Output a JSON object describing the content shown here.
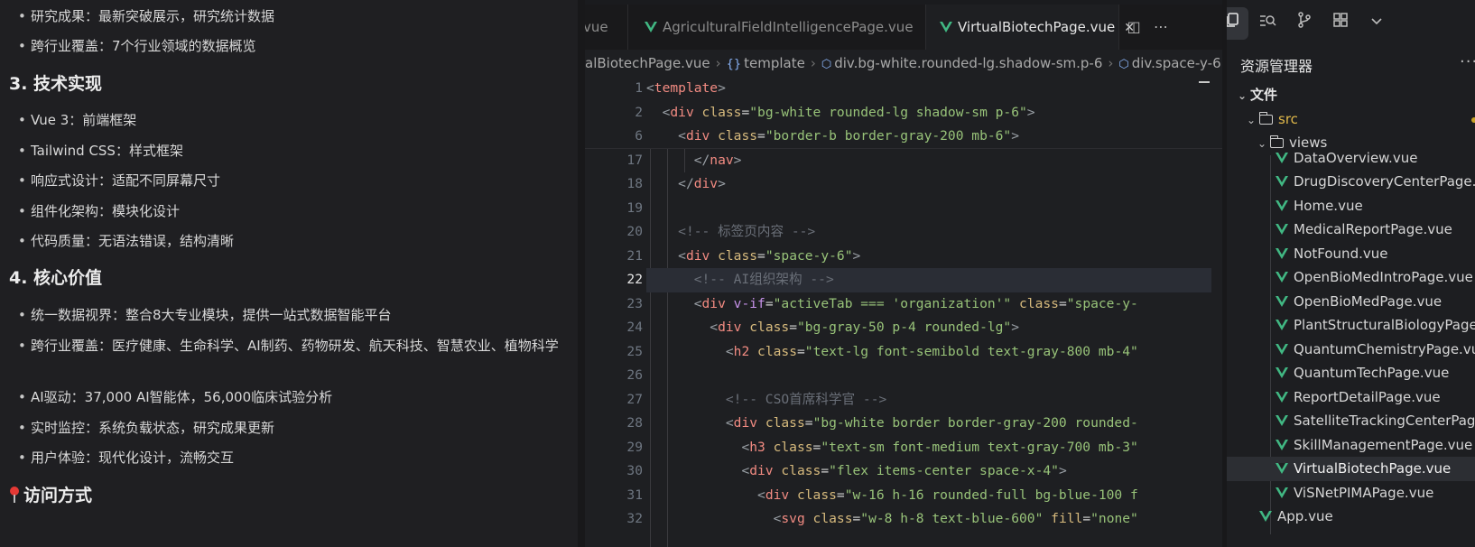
{
  "chat": {
    "items_top": [
      "研究成果：最新突破展示，研究统计数据",
      "跨行业覆盖：7个行业领域的数据概览"
    ],
    "section3_title": "3. 技术实现",
    "section3_items": [
      "Vue 3：前端框架",
      "Tailwind CSS：样式框架",
      "响应式设计：适配不同屏幕尺寸",
      "组件化架构：模块化设计",
      "代码质量：无语法错误，结构清晰"
    ],
    "section4_title": "4. 核心价值",
    "section4_items": [
      "统一数据视界：整合8大专业模块，提供一站式数据智能平台",
      "跨行业覆盖：医疗健康、生命科学、AI制药、药物研发、航天科技、智慧农业、植物科学",
      "AI驱动：37,000 AI智能体，56,000临床试验分析",
      "实时监控：系统负载状态，研究成果更新",
      "用户体验：现代化设计，流畅交互"
    ],
    "access_title": "访问方式"
  },
  "editor": {
    "tabs": [
      {
        "label": "vue",
        "active": false
      },
      {
        "label": "AgriculturalFieldIntelligencePage.vue",
        "active": false
      },
      {
        "label": "VirtualBiotechPage.vue",
        "active": true
      }
    ],
    "close_glyph": "✕",
    "split_glyph": "◫",
    "more_glyph": "⋯",
    "breadcrumb": [
      "alBiotechPage.vue",
      "template",
      "div.bg-white.rounded-lg.shadow-sm.p-6",
      "div.space-y-6"
    ],
    "breadcrumb_braces": "{}",
    "breadcrumb_symbol": "⬡",
    "current_line": 22
  },
  "explorer": {
    "title": "资源管理器",
    "more": "···",
    "section": "文件",
    "folders": [
      "src",
      "views"
    ],
    "files": [
      "DataOverview.vue",
      "DrugDiscoveryCenterPage.vue",
      "Home.vue",
      "MedicalReportPage.vue",
      "NotFound.vue",
      "OpenBioMedIntroPage.vue",
      "OpenBioMedPage.vue",
      "PlantStructuralBiologyPage.vue",
      "QuantumChemistryPage.vue",
      "QuantumTechPage.vue",
      "ReportDetailPage.vue",
      "SatelliteTrackingCenterPage.vue",
      "SkillManagementPage.vue",
      "VirtualBiotechPage.vue",
      "ViSNetPIMAPage.vue"
    ],
    "root_file": "App.vue",
    "selected_file": "VirtualBiotechPage.vue",
    "activity_icons": [
      "files-icon",
      "search-icon",
      "source-control-icon",
      "extensions-icon",
      "chevron-down-icon"
    ]
  },
  "colors": {
    "vue_green": "#41b883",
    "tag": "#f28b82",
    "attr": "#d7ba7d",
    "string": "#98c379",
    "comment": "#6a6f78"
  }
}
